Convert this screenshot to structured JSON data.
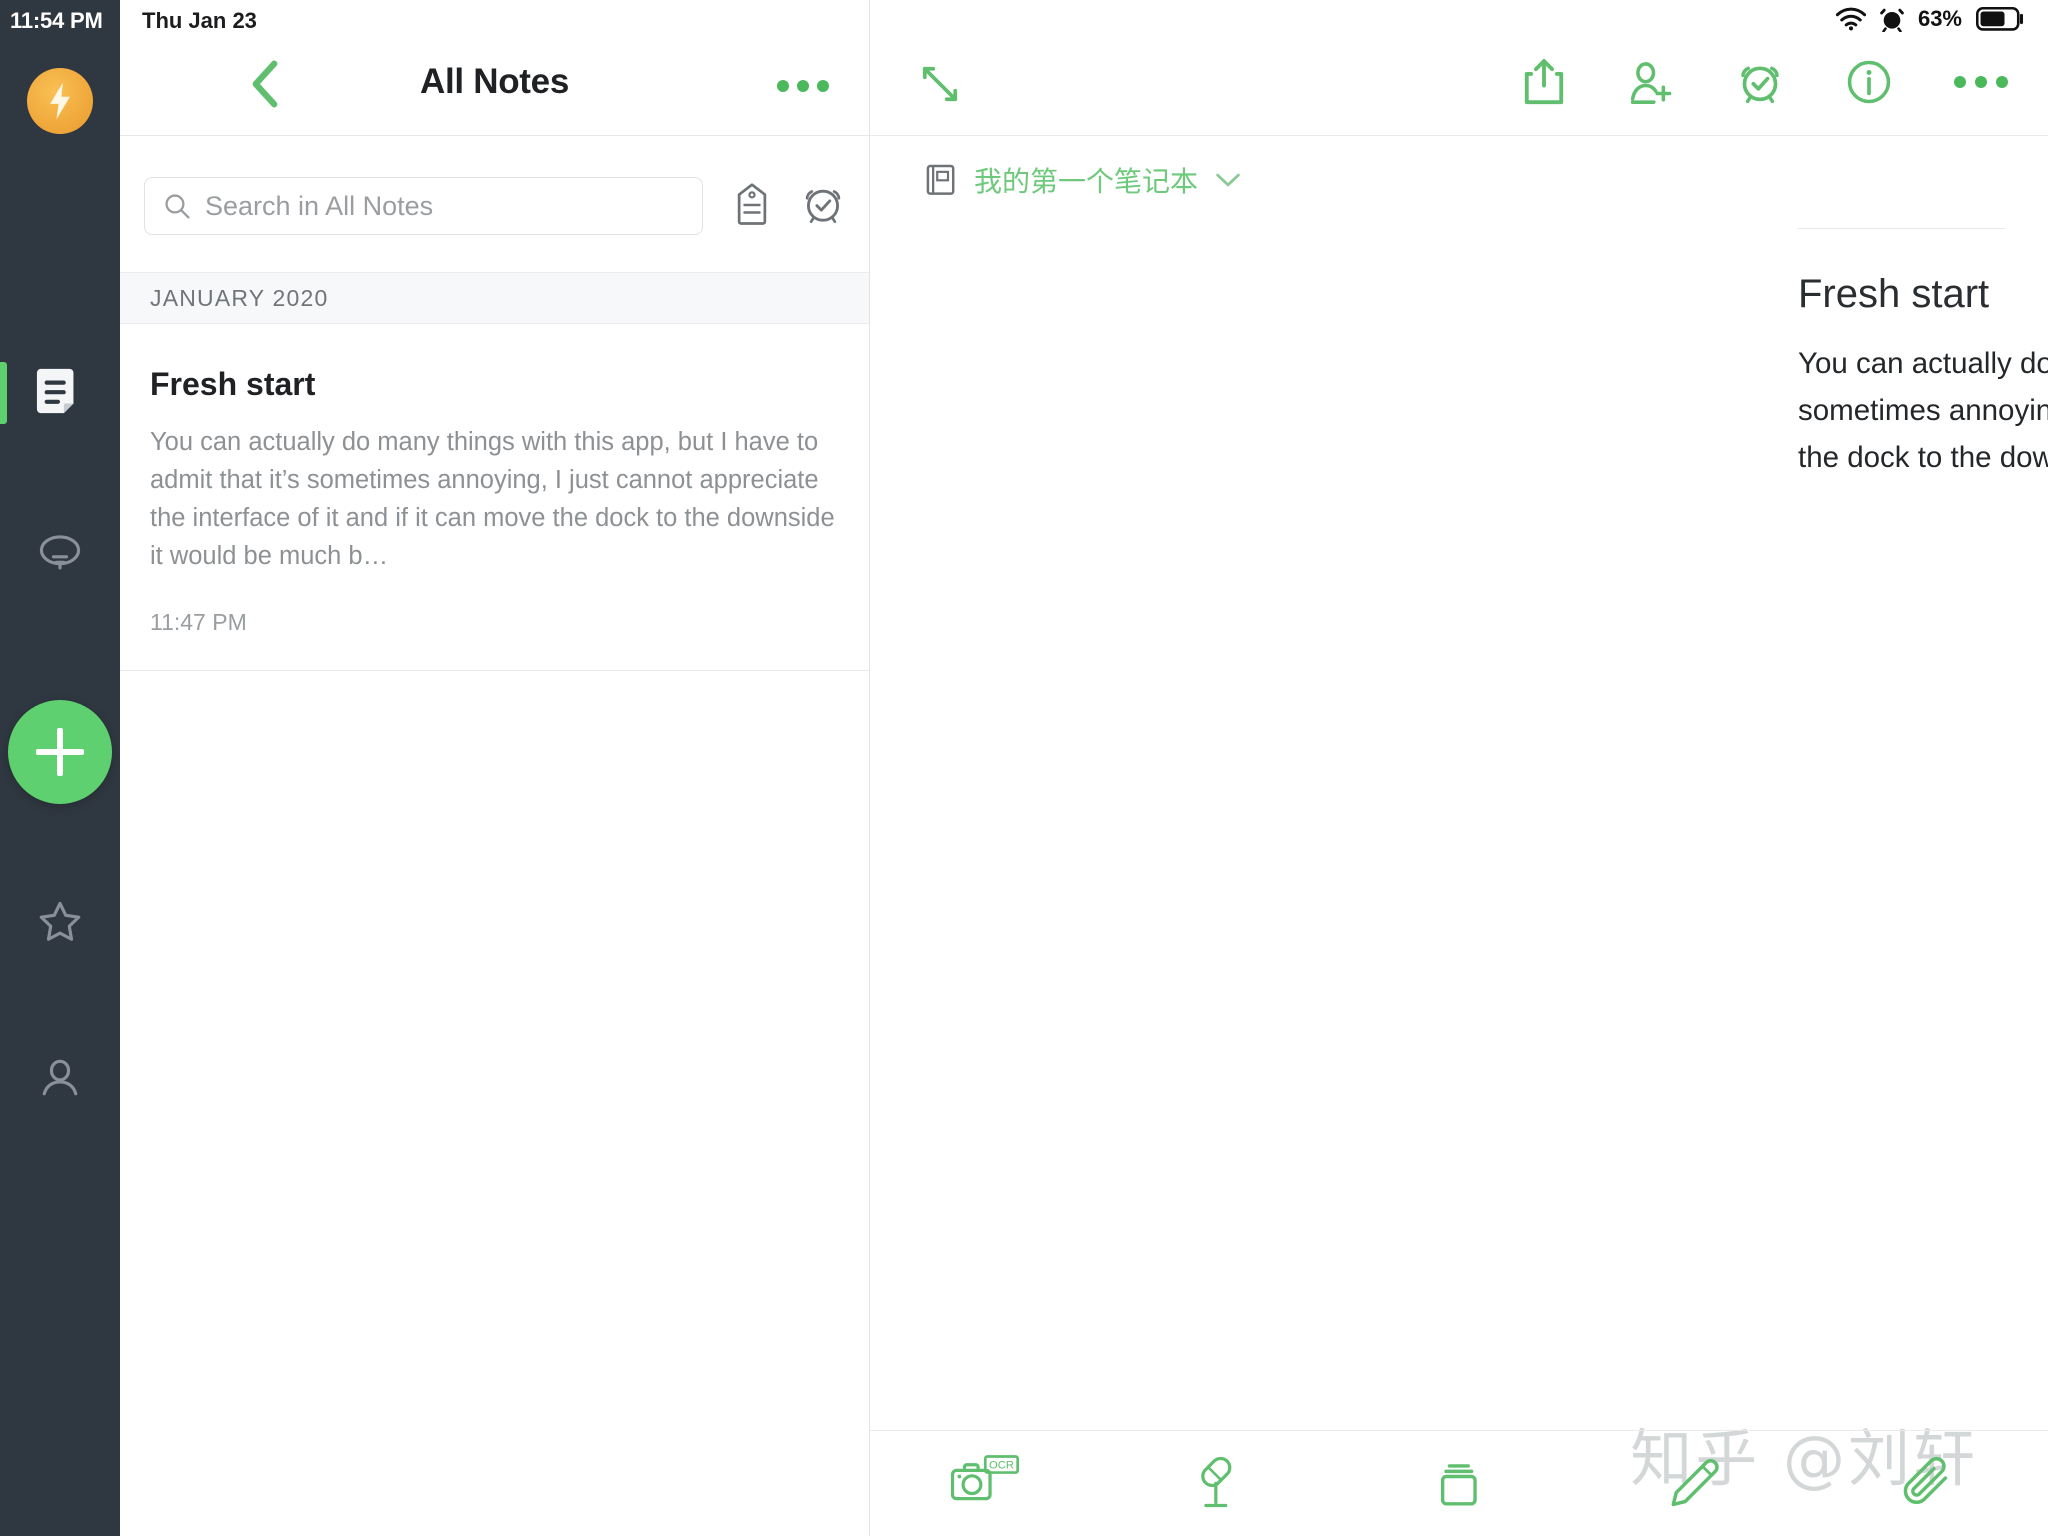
{
  "status_bar": {
    "time": "11:54 PM",
    "date": "Thu Jan 23",
    "wifi_icon": "wifi-icon",
    "alarm_icon": "alarm-icon",
    "battery_percent": "63%",
    "battery_icon": "battery-icon"
  },
  "dock": {
    "logo_icon": "lightning-bolt-logo",
    "items": [
      {
        "name": "notes",
        "icon": "note-document-icon",
        "active": true
      },
      {
        "name": "ideas",
        "icon": "lightbulb-icon",
        "active": false
      },
      {
        "name": "favorites",
        "icon": "star-icon",
        "active": false
      },
      {
        "name": "account",
        "icon": "person-icon",
        "active": false
      }
    ],
    "add_button": {
      "icon": "plus-icon",
      "label": "New"
    },
    "accent_color": "#5fd070",
    "background_color": "#2f3740",
    "logo_color": "#f0a93c"
  },
  "list_panel": {
    "back_icon": "chevron-left-icon",
    "title": "All Notes",
    "more_icon": "more-dots-icon",
    "search": {
      "icon": "search-icon",
      "placeholder": "Search in All Notes",
      "value": ""
    },
    "tag_icon": "tag-icon",
    "reminder_icon": "alarm-clock-icon",
    "section_header": "JANUARY 2020",
    "notes": [
      {
        "title": "Fresh start",
        "snippet": "You can actually do many things with this app, but I have to admit that it’s sometimes annoying, I just cannot appreciate the interface of it and if it can move the dock to the downside it would be much b…",
        "time": "11:47 PM"
      }
    ]
  },
  "editor": {
    "expand_icon": "expand-diagonal-icon",
    "toolbar": [
      {
        "name": "share",
        "icon": "share-upload-icon"
      },
      {
        "name": "add-collaborator",
        "icon": "person-add-icon"
      },
      {
        "name": "reminder",
        "icon": "alarm-check-icon"
      },
      {
        "name": "info",
        "icon": "info-circle-icon"
      },
      {
        "name": "more",
        "icon": "more-dots-icon"
      }
    ],
    "notebook": {
      "icon": "notebook-icon",
      "name": "我的第一个笔记本",
      "chevron": "chevron-down-icon"
    },
    "note": {
      "title": "Fresh start",
      "body": "You can actually do many things with this app, but I have to admit that it’s sometimes annoying, I just cannot appreciate the interface of it and if it can move the dock to the downside it would be much better."
    },
    "bottom_toolbar": [
      {
        "name": "camera-ocr",
        "icon": "camera-ocr-icon",
        "badge": "OCR"
      },
      {
        "name": "audio",
        "icon": "microphone-icon"
      },
      {
        "name": "cards",
        "icon": "card-stack-icon"
      },
      {
        "name": "handwriting",
        "icon": "pencil-icon"
      },
      {
        "name": "attachment",
        "icon": "paperclip-icon"
      }
    ],
    "accent_color": "#5fbf6e"
  },
  "watermark": "知乎 @刘轩"
}
